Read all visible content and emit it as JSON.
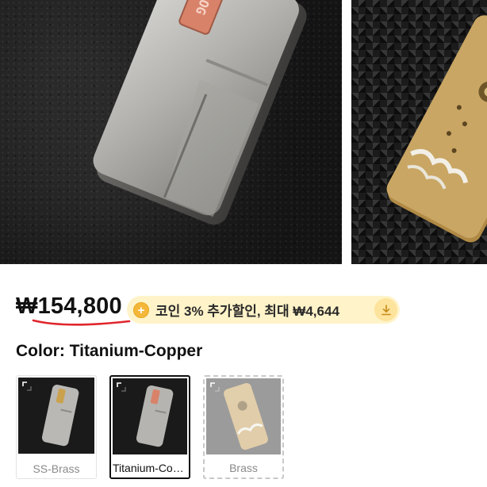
{
  "product": {
    "gallery": [
      {
        "name": "Titanium-Copper device on leather",
        "engraving": "DOG"
      },
      {
        "name": "Brass device on patterned mat"
      }
    ],
    "price": "₩154,800",
    "coupon": {
      "coin_symbol": "+",
      "text": "코인 3% 추가할인, 최대 ₩4,644",
      "icon": "download-icon"
    },
    "color": {
      "label": "Color: ",
      "selected_value": "Titanium-Copper"
    },
    "variants": [
      {
        "label": "SS-Brass",
        "state": "available"
      },
      {
        "label": "Titanium-Copper",
        "state": "selected"
      },
      {
        "label": "Brass",
        "state": "unavailable"
      }
    ]
  },
  "colors": {
    "accent_underline": "#e0262c",
    "coupon_bg": "#fff3c9",
    "coin": "#f4b73a"
  }
}
